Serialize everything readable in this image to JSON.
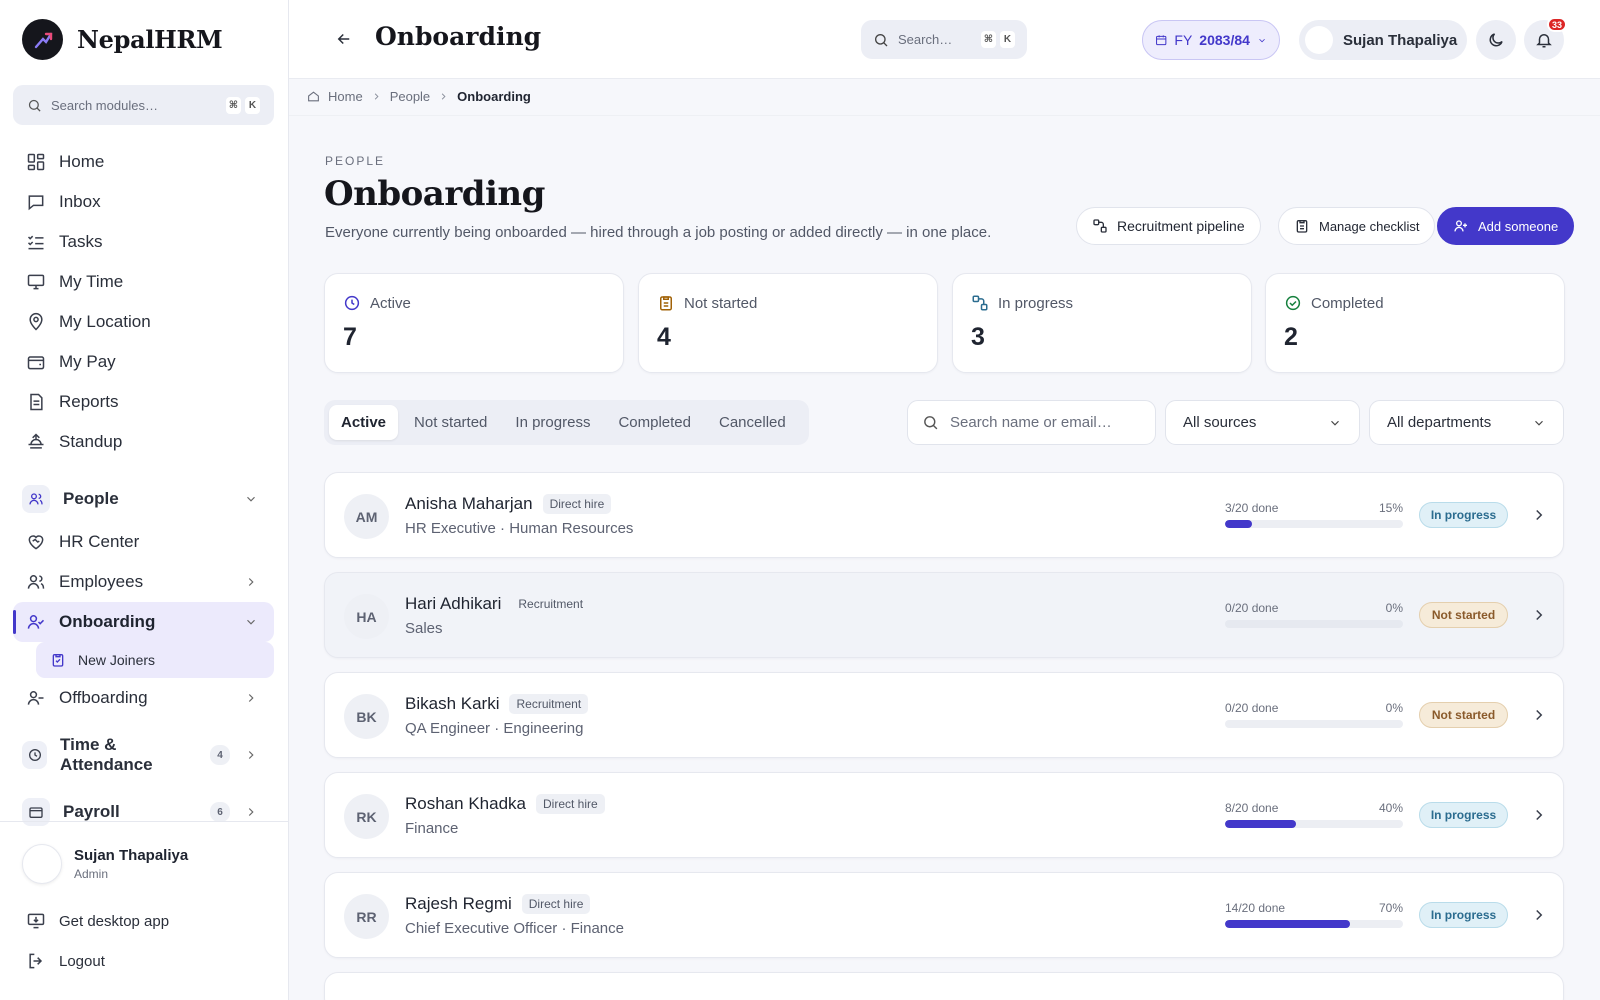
{
  "brand": {
    "name": "NepalHRM"
  },
  "sidebar": {
    "search_placeholder": "Search modules…",
    "search_kbd": [
      "⌘",
      "K"
    ],
    "items": [
      {
        "label": "Home"
      },
      {
        "label": "Inbox"
      },
      {
        "label": "Tasks"
      },
      {
        "label": "My Time"
      },
      {
        "label": "My Location"
      },
      {
        "label": "My Pay"
      },
      {
        "label": "Reports"
      },
      {
        "label": "Standup"
      }
    ],
    "groups": {
      "people": {
        "label": "People"
      },
      "hr_center": {
        "label": "HR Center"
      },
      "employees": {
        "label": "Employees"
      },
      "onboarding": {
        "label": "Onboarding"
      },
      "new_joiners": {
        "label": "New Joiners"
      },
      "offboarding": {
        "label": "Offboarding"
      },
      "time_attendance": {
        "label": "Time & Attendance",
        "count": "4"
      },
      "payroll": {
        "label": "Payroll",
        "count": "6"
      }
    },
    "user": {
      "name": "Sujan Thapaliya",
      "role": "Admin"
    },
    "desktop_app": "Get desktop app",
    "logout": "Logout"
  },
  "topbar": {
    "title": "Onboarding",
    "search_placeholder": "Search…",
    "search_kbd": [
      "⌘",
      "K"
    ],
    "fy_prefix": "FY",
    "fy_value": "2083/84",
    "user_name": "Sujan Thapaliya",
    "notifications": "33"
  },
  "breadcrumb": [
    "Home",
    "People",
    "Onboarding"
  ],
  "header": {
    "eyebrow": "PEOPLE",
    "title": "Onboarding",
    "subtitle": "Everyone currently being onboarded — hired through a job posting or added directly — in one place.",
    "buttons": {
      "pipeline": "Recruitment pipeline",
      "checklist": "Manage checklist",
      "add": "Add someone"
    }
  },
  "stats": [
    {
      "label": "Active",
      "value": "7",
      "icon": "clock-icon",
      "color": "#4338ca"
    },
    {
      "label": "Not started",
      "value": "4",
      "icon": "clipboard-icon",
      "color": "#a16207"
    },
    {
      "label": "In progress",
      "value": "3",
      "icon": "flow-icon",
      "color": "#2b6c8f"
    },
    {
      "label": "Completed",
      "value": "2",
      "icon": "check-circle-icon",
      "color": "#15803d"
    }
  ],
  "tabs": [
    "Active",
    "Not started",
    "In progress",
    "Completed",
    "Cancelled"
  ],
  "filters": {
    "search_placeholder": "Search name or email…",
    "source": "All sources",
    "department": "All departments"
  },
  "rows": [
    {
      "initials": "AM",
      "name": "Anisha Maharjan",
      "tag": "Direct hire",
      "sub": "HR Executive · Human Resources",
      "done": "3/20 done",
      "pct": "15%",
      "progress": 0.15,
      "status": "In progress",
      "status_kind": "progress"
    },
    {
      "initials": "HA",
      "name": "Hari Adhikari",
      "tag": "Recruitment",
      "sub": "Sales",
      "done": "0/20 done",
      "pct": "0%",
      "progress": 0,
      "status": "Not started",
      "status_kind": "not"
    },
    {
      "initials": "BK",
      "name": "Bikash Karki",
      "tag": "Recruitment",
      "sub": "QA Engineer · Engineering",
      "done": "0/20 done",
      "pct": "0%",
      "progress": 0,
      "status": "Not started",
      "status_kind": "not"
    },
    {
      "initials": "RK",
      "name": "Roshan Khadka",
      "tag": "Direct hire",
      "sub": "Finance",
      "done": "8/20 done",
      "pct": "40%",
      "progress": 0.4,
      "status": "In progress",
      "status_kind": "progress"
    },
    {
      "initials": "RR",
      "name": "Rajesh Regmi",
      "tag": "Direct hire",
      "sub": "Chief Executive Officer · Finance",
      "done": "14/20 done",
      "pct": "70%",
      "progress": 0.7,
      "status": "In progress",
      "status_kind": "progress"
    }
  ],
  "colors": {
    "accent": "#4338ca",
    "danger": "#dc2626"
  }
}
